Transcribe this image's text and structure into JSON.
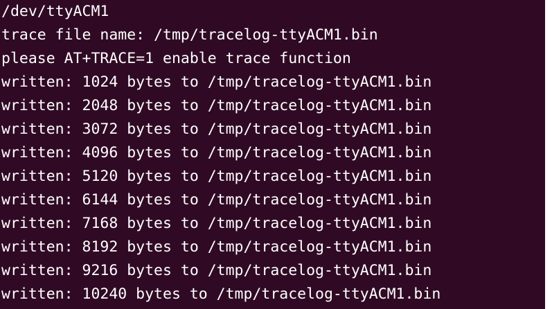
{
  "terminal": {
    "colors": {
      "background": "#300a24",
      "foreground": "#ffffff"
    },
    "lines": [
      "/dev/ttyACM1",
      "trace file name: /tmp/tracelog-ttyACM1.bin",
      "please AT+TRACE=1 enable trace function",
      "written: 1024 bytes to /tmp/tracelog-ttyACM1.bin",
      "written: 2048 bytes to /tmp/tracelog-ttyACM1.bin",
      "written: 3072 bytes to /tmp/tracelog-ttyACM1.bin",
      "written: 4096 bytes to /tmp/tracelog-ttyACM1.bin",
      "written: 5120 bytes to /tmp/tracelog-ttyACM1.bin",
      "written: 6144 bytes to /tmp/tracelog-ttyACM1.bin",
      "written: 7168 bytes to /tmp/tracelog-ttyACM1.bin",
      "written: 8192 bytes to /tmp/tracelog-ttyACM1.bin",
      "written: 9216 bytes to /tmp/tracelog-ttyACM1.bin",
      "written: 10240 bytes to /tmp/tracelog-ttyACM1.bin"
    ]
  }
}
